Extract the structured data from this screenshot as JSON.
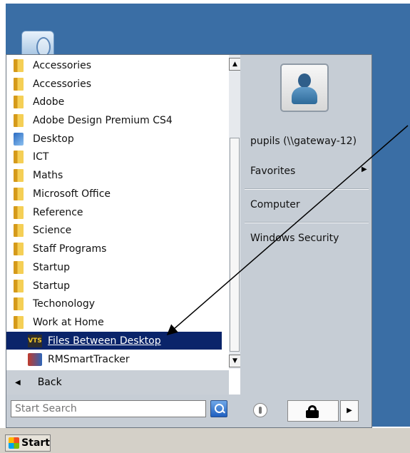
{
  "programs": [
    {
      "label": "Accessories",
      "icon": "folder-icon"
    },
    {
      "label": "Accessories",
      "icon": "folder-icon"
    },
    {
      "label": "Adobe",
      "icon": "folder-icon"
    },
    {
      "label": "Adobe Design Premium CS4",
      "icon": "folder-icon"
    },
    {
      "label": "Desktop",
      "icon": "desktop-icon"
    },
    {
      "label": "ICT",
      "icon": "folder-icon"
    },
    {
      "label": "Maths",
      "icon": "folder-icon"
    },
    {
      "label": "Microsoft Office",
      "icon": "folder-icon"
    },
    {
      "label": "Reference",
      "icon": "folder-icon"
    },
    {
      "label": "Science",
      "icon": "folder-icon"
    },
    {
      "label": "Staff Programs",
      "icon": "folder-icon"
    },
    {
      "label": "Startup",
      "icon": "folder-icon"
    },
    {
      "label": "Startup",
      "icon": "folder-icon"
    },
    {
      "label": "Techonology",
      "icon": "folder-icon"
    },
    {
      "label": "Work at Home",
      "icon": "folder-icon"
    },
    {
      "label": "Files Between Desktop",
      "icon": "vts-icon",
      "selected": true
    },
    {
      "label": "RMSmartTracker",
      "icon": "rmsmarttracker-icon"
    }
  ],
  "vts_icon_text": "VTS",
  "back_label": "Back",
  "search": {
    "placeholder": "Start Search"
  },
  "right_panel": {
    "user": "pupils (\\\\gateway-12)",
    "favorites": "Favorites",
    "computer": "Computer",
    "windows_security": "Windows Security"
  },
  "taskbar": {
    "start_label": "Start"
  },
  "colors": {
    "desktop": "#3a6ea5",
    "selection": "#0a246a"
  }
}
